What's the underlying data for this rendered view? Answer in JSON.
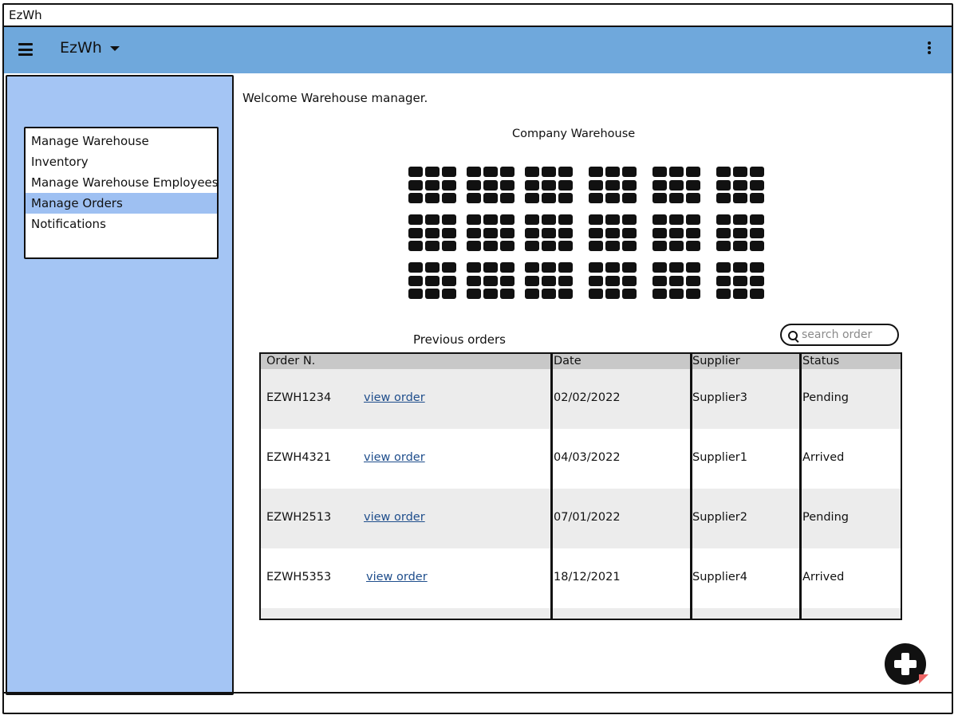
{
  "window": {
    "title": "EzWh"
  },
  "appbar": {
    "title": "EzWh",
    "menu_icon": "hamburger-icon",
    "more_icon": "kebab-icon",
    "color": "#6fa8dc"
  },
  "sidebar": {
    "color": "#a4c5f4",
    "items": [
      {
        "label": "Manage Warehouse",
        "active": false
      },
      {
        "label": "Inventory",
        "active": false
      },
      {
        "label": "Manage Warehouse Employees",
        "active": false
      },
      {
        "label": "Manage Orders",
        "active": true
      },
      {
        "label": "Notifications",
        "active": false
      }
    ]
  },
  "main": {
    "welcome": "Welcome Warehouse manager.",
    "warehouse_title": "Company Warehouse",
    "orders_title": "Previous orders",
    "search": {
      "placeholder": "search order",
      "value": ""
    },
    "table": {
      "columns": [
        "Order N.",
        "Date",
        "Supplier",
        "Status"
      ],
      "rows": [
        {
          "order": "EZWH1234",
          "link": "view order",
          "date": "02/02/2022",
          "supplier": "Supplier3",
          "status": "Pending"
        },
        {
          "order": "EZWH4321",
          "link": "view order",
          "date": "04/03/2022",
          "supplier": "Supplier1",
          "status": "Arrived"
        },
        {
          "order": "EZWH2513",
          "link": "view order",
          "date": "07/01/2022",
          "supplier": "Supplier2",
          "status": "Pending"
        },
        {
          "order": "EZWH5353",
          "link": "view order",
          "date": "18/12/2021",
          "supplier": "Supplier4",
          "status": "Arrived"
        }
      ]
    },
    "fab_icon": "add-circle-icon"
  }
}
